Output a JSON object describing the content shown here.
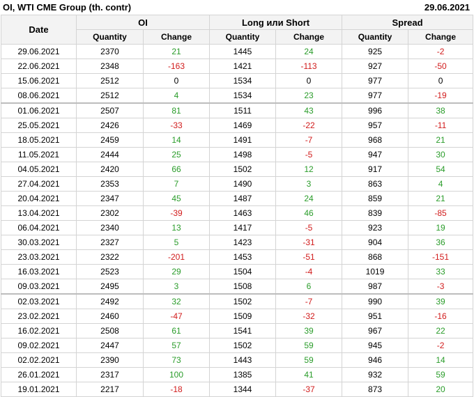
{
  "header": {
    "title": "OI, WTI CME Group (th. contr)",
    "date": "29.06.2021"
  },
  "columns": {
    "date": "Date",
    "groups": [
      "OI",
      "Long или Short",
      "Spread"
    ],
    "sub": [
      "Quantity",
      "Change",
      "Quantity",
      "Change",
      "Quantity",
      "Change"
    ]
  },
  "rows": [
    [
      "29.06.2021",
      "2370",
      "21",
      "1445",
      "24",
      "925",
      "-2"
    ],
    [
      "22.06.2021",
      "2348",
      "-163",
      "1421",
      "-113",
      "927",
      "-50"
    ],
    [
      "15.06.2021",
      "2512",
      "0",
      "1534",
      "0",
      "977",
      "0"
    ],
    [
      "08.06.2021",
      "2512",
      "4",
      "1534",
      "23",
      "977",
      "-19"
    ],
    [
      "01.06.2021",
      "2507",
      "81",
      "1511",
      "43",
      "996",
      "38"
    ],
    [
      "25.05.2021",
      "2426",
      "-33",
      "1469",
      "-22",
      "957",
      "-11"
    ],
    [
      "18.05.2021",
      "2459",
      "14",
      "1491",
      "-7",
      "968",
      "21"
    ],
    [
      "11.05.2021",
      "2444",
      "25",
      "1498",
      "-5",
      "947",
      "30"
    ],
    [
      "04.05.2021",
      "2420",
      "66",
      "1502",
      "12",
      "917",
      "54"
    ],
    [
      "27.04.2021",
      "2353",
      "7",
      "1490",
      "3",
      "863",
      "4"
    ],
    [
      "20.04.2021",
      "2347",
      "45",
      "1487",
      "24",
      "859",
      "21"
    ],
    [
      "13.04.2021",
      "2302",
      "-39",
      "1463",
      "46",
      "839",
      "-85"
    ],
    [
      "06.04.2021",
      "2340",
      "13",
      "1417",
      "-5",
      "923",
      "19"
    ],
    [
      "30.03.2021",
      "2327",
      "5",
      "1423",
      "-31",
      "904",
      "36"
    ],
    [
      "23.03.2021",
      "2322",
      "-201",
      "1453",
      "-51",
      "868",
      "-151"
    ],
    [
      "16.03.2021",
      "2523",
      "29",
      "1504",
      "-4",
      "1019",
      "33"
    ],
    [
      "09.03.2021",
      "2495",
      "3",
      "1508",
      "6",
      "987",
      "-3"
    ],
    [
      "02.03.2021",
      "2492",
      "32",
      "1502",
      "-7",
      "990",
      "39"
    ],
    [
      "23.02.2021",
      "2460",
      "-47",
      "1509",
      "-32",
      "951",
      "-16"
    ],
    [
      "16.02.2021",
      "2508",
      "61",
      "1541",
      "39",
      "967",
      "22"
    ],
    [
      "09.02.2021",
      "2447",
      "57",
      "1502",
      "59",
      "945",
      "-2"
    ],
    [
      "02.02.2021",
      "2390",
      "73",
      "1443",
      "59",
      "946",
      "14"
    ],
    [
      "26.01.2021",
      "2317",
      "100",
      "1385",
      "41",
      "932",
      "59"
    ],
    [
      "19.01.2021",
      "2217",
      "-18",
      "1344",
      "-37",
      "873",
      "20"
    ]
  ],
  "separator_before_rows": [
    4,
    17
  ],
  "colors": {
    "positive": "#2a9c2a",
    "negative": "#d11b1b",
    "header_bg": "#f3f3f3",
    "border": "#d4d4d4"
  }
}
